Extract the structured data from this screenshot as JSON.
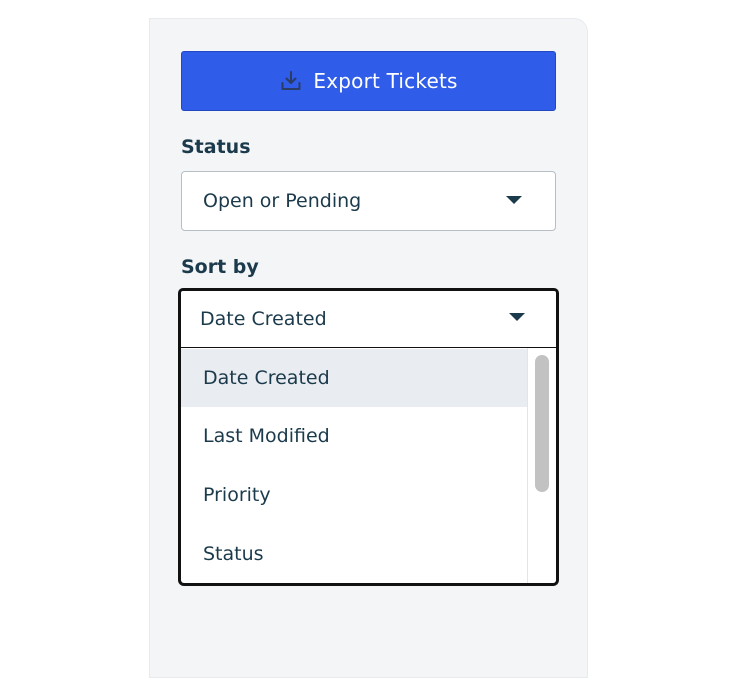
{
  "export": {
    "label": "Export Tickets",
    "icon": "download-tray-icon",
    "color": "#2f5ce8"
  },
  "status_filter": {
    "label": "Status",
    "value": "Open or Pending"
  },
  "sort_filter": {
    "label": "Sort by",
    "value": "Date Created",
    "options": [
      {
        "label": "Date Created",
        "highlighted": true
      },
      {
        "label": "Last Modified",
        "highlighted": false
      },
      {
        "label": "Priority",
        "highlighted": false
      },
      {
        "label": "Status",
        "highlighted": false
      }
    ]
  }
}
